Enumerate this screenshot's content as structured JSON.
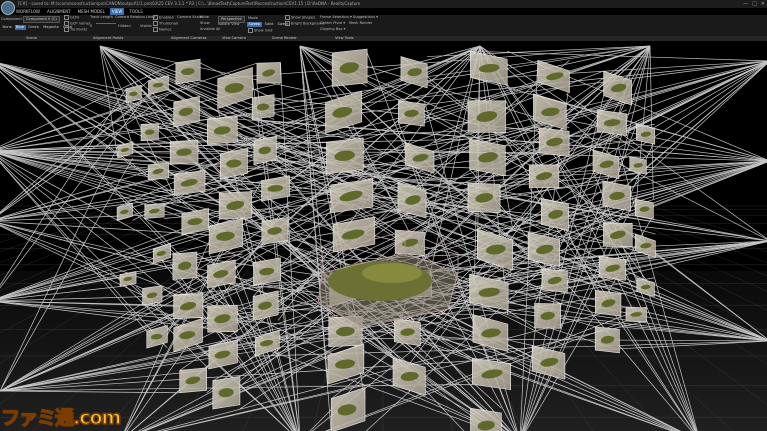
{
  "titlebar": {
    "path": "[C#] - saved to: M:\\scan\\reconstruction\\pro\\CANON\\output\\1\\1.pre\\03\\25 CEV 3.3.1 * R3 | C:\\...\\BreadTest\\CaptureTest\\Reconstruction\\CEV1.15 | D:\\ReDNA - RealityCapture",
    "controls": [
      "—",
      "□",
      "✕"
    ]
  },
  "menu": [
    "WORKFLOW",
    "ALIGNMENT",
    "MESH MODEL",
    "VIEW",
    "TOOLS"
  ],
  "menu_active": "VIEW",
  "ribbon": {
    "component_label": "Component",
    "component_value": "Component 0 (C)",
    "shade_buttons": [
      "None",
      "Blue",
      "Green",
      "Magenta",
      "Coral"
    ],
    "shade_active": "Blue",
    "checks1": [
      "GCPs",
      "GCP names",
      "Tie Points"
    ],
    "track_length": "Track Length",
    "slider_labels": [
      "0",
      "Hidden"
    ],
    "camera_relation": "Camera Relation Lines",
    "visible": "Visible",
    "checks2": [
      "Enabled",
      "Thumbnail",
      "Names"
    ],
    "camera_scale": "Camera Scale",
    "camera_scale_value": "Wide",
    "show": "Show",
    "invisible_all": "Invisible All",
    "perspective": "Perspective",
    "isolate_view": "Isolate View",
    "mode": "Mode",
    "render_buttons": [
      "Sweep",
      "Solid",
      "Sweet"
    ],
    "render_active": "Sweep",
    "show_grid": "Show Grid",
    "show_shapes": "Show Shapes",
    "bright_bg": "Bright Background",
    "frame_selection": "Frame Selection",
    "suggestions": "Suggestions",
    "center_pivot": "Center Pivot",
    "mesh_render": "Mesh Render",
    "clipping_box": "Clipping Box"
  },
  "groups": [
    "Scene",
    "Alignment Points",
    "Alignment Cameras",
    "View Camera",
    "Scene Render",
    "View Tools"
  ],
  "watermark": "ファミ通.com"
}
